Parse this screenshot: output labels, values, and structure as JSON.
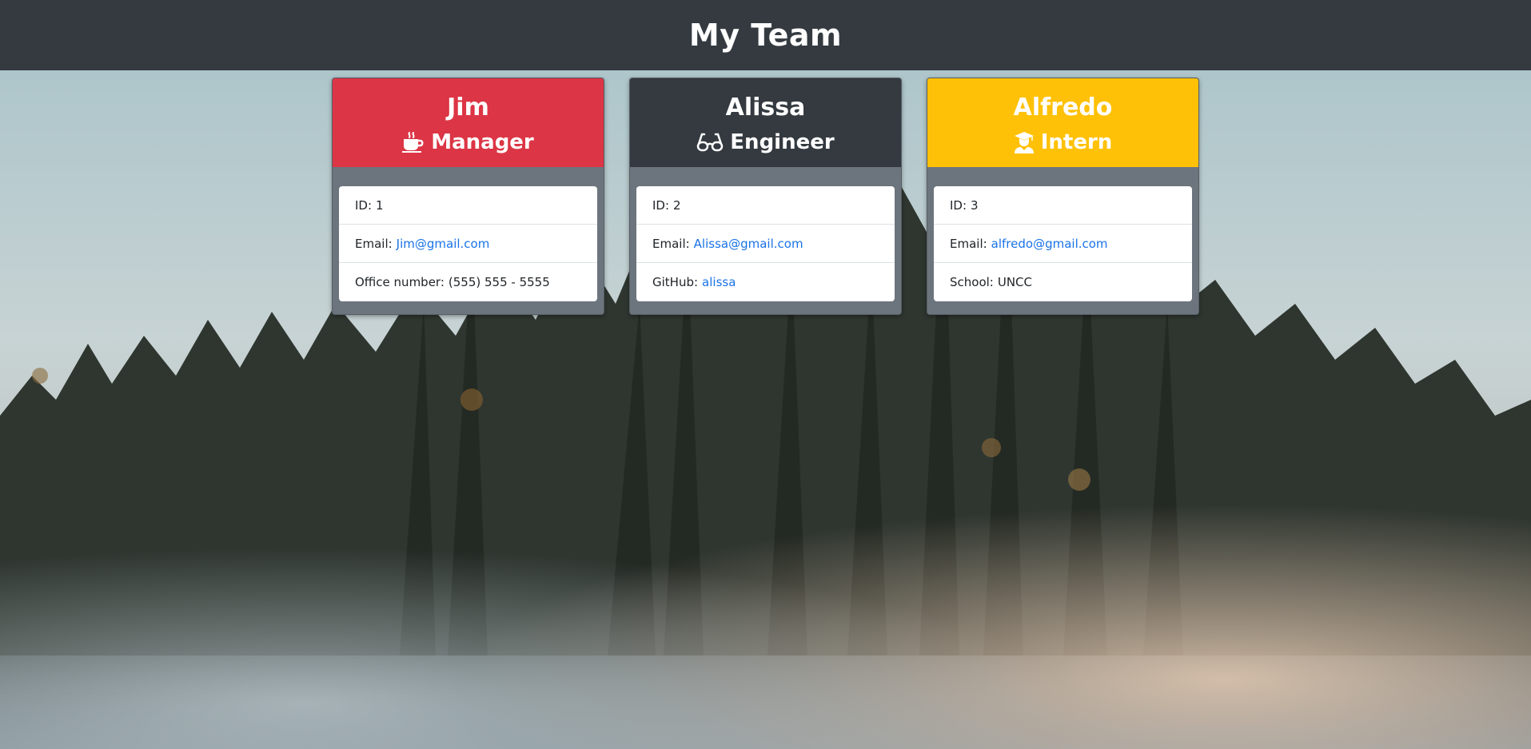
{
  "header": {
    "title": "My Team"
  },
  "employees": [
    {
      "name": "Jim",
      "role": "Manager",
      "icon": "coffee-icon",
      "color": "#dc3545",
      "id_label": "ID:",
      "id": "1",
      "email_label": "Email:",
      "email": "Jim@gmail.com",
      "extra_label": "Office number:",
      "extra": "(555) 555 - 5555"
    },
    {
      "name": "Alissa",
      "role": "Engineer",
      "icon": "glasses-icon",
      "color": "#343a40",
      "id_label": "ID:",
      "id": "2",
      "email_label": "Email:",
      "email": "Alissa@gmail.com",
      "extra_label": "GitHub:",
      "extra": "alissa"
    },
    {
      "name": "Alfredo",
      "role": "Intern",
      "icon": "graduate-icon",
      "color": "#ffc107",
      "id_label": "ID:",
      "id": "3",
      "email_label": "Email:",
      "email": "alfredo@gmail.com",
      "extra_label": "School:",
      "extra": "UNCC"
    }
  ]
}
